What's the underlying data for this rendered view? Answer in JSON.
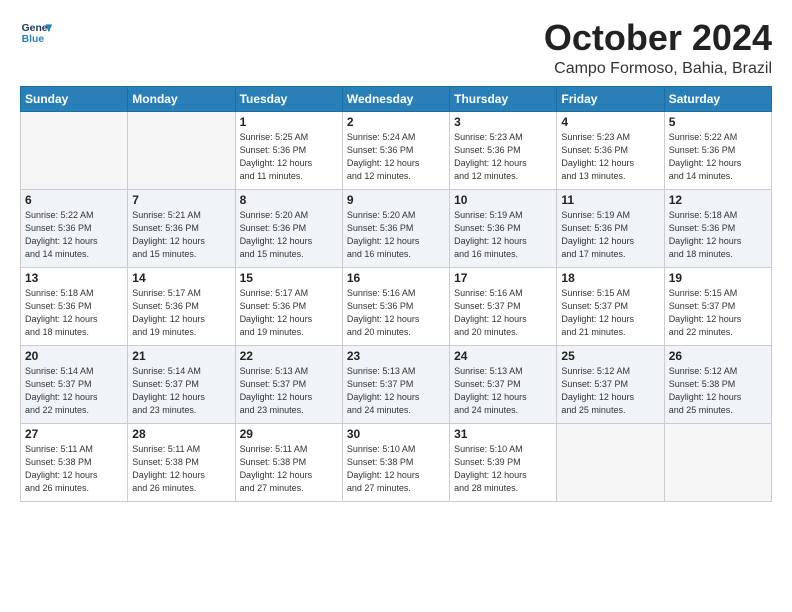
{
  "logo": {
    "line1": "General",
    "line2": "Blue"
  },
  "title": "October 2024",
  "location": "Campo Formoso, Bahia, Brazil",
  "weekdays": [
    "Sunday",
    "Monday",
    "Tuesday",
    "Wednesday",
    "Thursday",
    "Friday",
    "Saturday"
  ],
  "weeks": [
    [
      {
        "day": "",
        "detail": ""
      },
      {
        "day": "",
        "detail": ""
      },
      {
        "day": "1",
        "detail": "Sunrise: 5:25 AM\nSunset: 5:36 PM\nDaylight: 12 hours\nand 11 minutes."
      },
      {
        "day": "2",
        "detail": "Sunrise: 5:24 AM\nSunset: 5:36 PM\nDaylight: 12 hours\nand 12 minutes."
      },
      {
        "day": "3",
        "detail": "Sunrise: 5:23 AM\nSunset: 5:36 PM\nDaylight: 12 hours\nand 12 minutes."
      },
      {
        "day": "4",
        "detail": "Sunrise: 5:23 AM\nSunset: 5:36 PM\nDaylight: 12 hours\nand 13 minutes."
      },
      {
        "day": "5",
        "detail": "Sunrise: 5:22 AM\nSunset: 5:36 PM\nDaylight: 12 hours\nand 14 minutes."
      }
    ],
    [
      {
        "day": "6",
        "detail": "Sunrise: 5:22 AM\nSunset: 5:36 PM\nDaylight: 12 hours\nand 14 minutes."
      },
      {
        "day": "7",
        "detail": "Sunrise: 5:21 AM\nSunset: 5:36 PM\nDaylight: 12 hours\nand 15 minutes."
      },
      {
        "day": "8",
        "detail": "Sunrise: 5:20 AM\nSunset: 5:36 PM\nDaylight: 12 hours\nand 15 minutes."
      },
      {
        "day": "9",
        "detail": "Sunrise: 5:20 AM\nSunset: 5:36 PM\nDaylight: 12 hours\nand 16 minutes."
      },
      {
        "day": "10",
        "detail": "Sunrise: 5:19 AM\nSunset: 5:36 PM\nDaylight: 12 hours\nand 16 minutes."
      },
      {
        "day": "11",
        "detail": "Sunrise: 5:19 AM\nSunset: 5:36 PM\nDaylight: 12 hours\nand 17 minutes."
      },
      {
        "day": "12",
        "detail": "Sunrise: 5:18 AM\nSunset: 5:36 PM\nDaylight: 12 hours\nand 18 minutes."
      }
    ],
    [
      {
        "day": "13",
        "detail": "Sunrise: 5:18 AM\nSunset: 5:36 PM\nDaylight: 12 hours\nand 18 minutes."
      },
      {
        "day": "14",
        "detail": "Sunrise: 5:17 AM\nSunset: 5:36 PM\nDaylight: 12 hours\nand 19 minutes."
      },
      {
        "day": "15",
        "detail": "Sunrise: 5:17 AM\nSunset: 5:36 PM\nDaylight: 12 hours\nand 19 minutes."
      },
      {
        "day": "16",
        "detail": "Sunrise: 5:16 AM\nSunset: 5:36 PM\nDaylight: 12 hours\nand 20 minutes."
      },
      {
        "day": "17",
        "detail": "Sunrise: 5:16 AM\nSunset: 5:37 PM\nDaylight: 12 hours\nand 20 minutes."
      },
      {
        "day": "18",
        "detail": "Sunrise: 5:15 AM\nSunset: 5:37 PM\nDaylight: 12 hours\nand 21 minutes."
      },
      {
        "day": "19",
        "detail": "Sunrise: 5:15 AM\nSunset: 5:37 PM\nDaylight: 12 hours\nand 22 minutes."
      }
    ],
    [
      {
        "day": "20",
        "detail": "Sunrise: 5:14 AM\nSunset: 5:37 PM\nDaylight: 12 hours\nand 22 minutes."
      },
      {
        "day": "21",
        "detail": "Sunrise: 5:14 AM\nSunset: 5:37 PM\nDaylight: 12 hours\nand 23 minutes."
      },
      {
        "day": "22",
        "detail": "Sunrise: 5:13 AM\nSunset: 5:37 PM\nDaylight: 12 hours\nand 23 minutes."
      },
      {
        "day": "23",
        "detail": "Sunrise: 5:13 AM\nSunset: 5:37 PM\nDaylight: 12 hours\nand 24 minutes."
      },
      {
        "day": "24",
        "detail": "Sunrise: 5:13 AM\nSunset: 5:37 PM\nDaylight: 12 hours\nand 24 minutes."
      },
      {
        "day": "25",
        "detail": "Sunrise: 5:12 AM\nSunset: 5:37 PM\nDaylight: 12 hours\nand 25 minutes."
      },
      {
        "day": "26",
        "detail": "Sunrise: 5:12 AM\nSunset: 5:38 PM\nDaylight: 12 hours\nand 25 minutes."
      }
    ],
    [
      {
        "day": "27",
        "detail": "Sunrise: 5:11 AM\nSunset: 5:38 PM\nDaylight: 12 hours\nand 26 minutes."
      },
      {
        "day": "28",
        "detail": "Sunrise: 5:11 AM\nSunset: 5:38 PM\nDaylight: 12 hours\nand 26 minutes."
      },
      {
        "day": "29",
        "detail": "Sunrise: 5:11 AM\nSunset: 5:38 PM\nDaylight: 12 hours\nand 27 minutes."
      },
      {
        "day": "30",
        "detail": "Sunrise: 5:10 AM\nSunset: 5:38 PM\nDaylight: 12 hours\nand 27 minutes."
      },
      {
        "day": "31",
        "detail": "Sunrise: 5:10 AM\nSunset: 5:39 PM\nDaylight: 12 hours\nand 28 minutes."
      },
      {
        "day": "",
        "detail": ""
      },
      {
        "day": "",
        "detail": ""
      }
    ]
  ]
}
